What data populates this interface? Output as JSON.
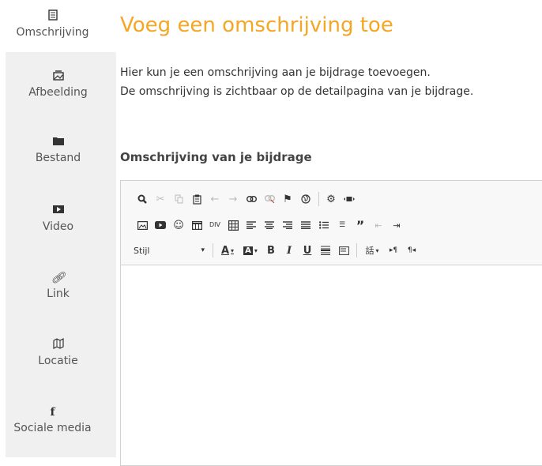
{
  "sidebar": {
    "items": [
      {
        "label": "Omschrijving",
        "icon": "document-icon"
      },
      {
        "label": "Afbeelding",
        "icon": "image-icon"
      },
      {
        "label": "Bestand",
        "icon": "folder-icon"
      },
      {
        "label": "Video",
        "icon": "video-icon"
      },
      {
        "label": "Link",
        "icon": "link-icon"
      },
      {
        "label": "Locatie",
        "icon": "map-icon"
      },
      {
        "label": "Sociale media",
        "icon": "facebook-icon"
      }
    ]
  },
  "main": {
    "title": "Voeg een omschrijving toe",
    "intro_line1": "Hier kun je een omschrijving aan je bijdrage toevoegen.",
    "intro_line2": "De omschrijving is zichtbaar op de detailpagina van je bijdrage.",
    "field_label": "Omschrijving van je bijdrage"
  },
  "editor": {
    "style_combo": "Stijl"
  },
  "colors": {
    "accent": "#f5a623",
    "sidebar_bg": "#f0f0f0"
  }
}
